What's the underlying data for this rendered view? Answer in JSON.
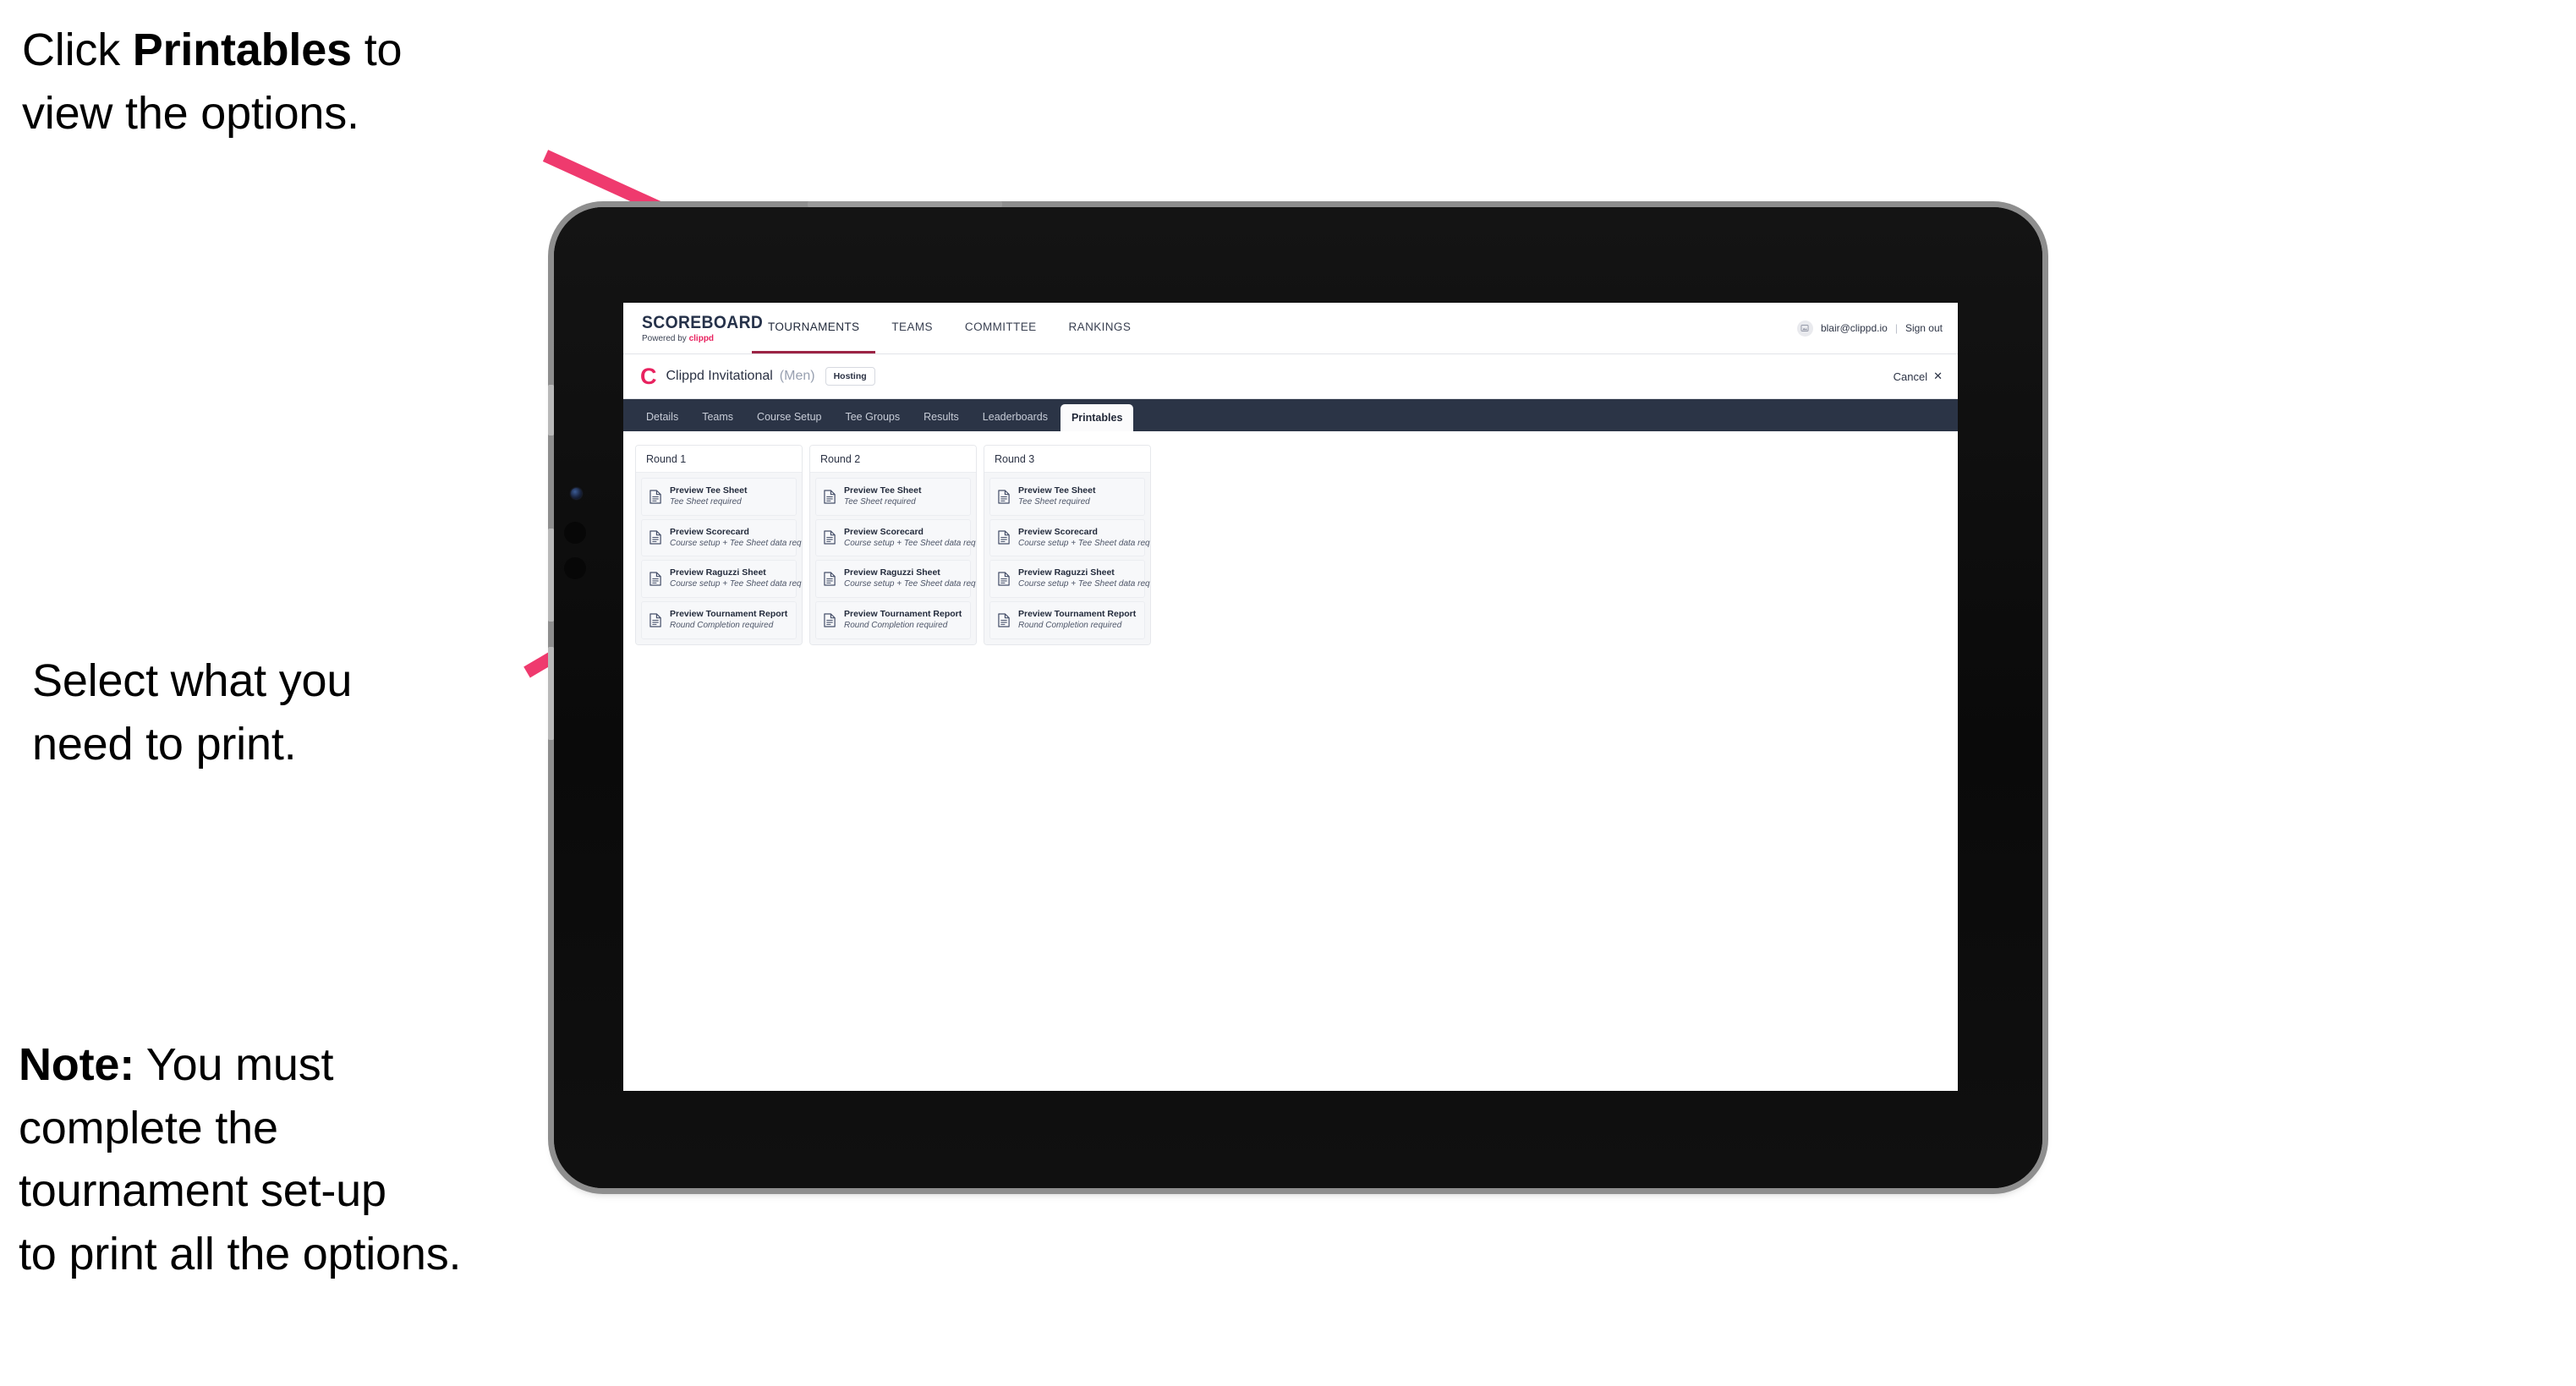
{
  "annotations": {
    "click_printables": "Click Printables to\nview the options.",
    "click_printables_bold": "Printables",
    "click_printables_pre": "Click ",
    "click_printables_post": " to\nview the options.",
    "select_print": "Select what you\n need to print.",
    "note_bold": "Note:",
    "note_rest": " You must\ncomplete the\ntournament set-up\nto print all the options."
  },
  "colors": {
    "accent_pink": "#ef3a6e",
    "brand_pink": "#e8225f",
    "navy": "#2b3446",
    "active_underline": "#9c2345"
  },
  "screen": {
    "appbar": {
      "brand_title": "SCOREBOARD",
      "brand_sub_prefix": "Powered by ",
      "brand_sub_name": "clippd",
      "nav": [
        {
          "label": "TOURNAMENTS",
          "active": true
        },
        {
          "label": "TEAMS",
          "active": false
        },
        {
          "label": "COMMITTEE",
          "active": false
        },
        {
          "label": "RANKINGS",
          "active": false
        }
      ],
      "user_email": "blair@clippd.io",
      "divider": "|",
      "sign_out": "Sign out",
      "avatar_glyph": "▣"
    },
    "tournament_bar": {
      "logo_letter": "C",
      "name": "Clippd Invitational",
      "gender": "(Men)",
      "badge": "Hosting",
      "cancel_label": "Cancel",
      "cancel_glyph": "✕"
    },
    "subnav": [
      {
        "label": "Details",
        "active": false
      },
      {
        "label": "Teams",
        "active": false
      },
      {
        "label": "Course Setup",
        "active": false
      },
      {
        "label": "Tee Groups",
        "active": false
      },
      {
        "label": "Results",
        "active": false
      },
      {
        "label": "Leaderboards",
        "active": false
      },
      {
        "label": "Printables",
        "active": true
      }
    ],
    "rounds": [
      {
        "title": "Round 1",
        "items": [
          {
            "title": "Preview Tee Sheet",
            "sub": "Tee Sheet required"
          },
          {
            "title": "Preview Scorecard",
            "sub": "Course setup + Tee Sheet data required"
          },
          {
            "title": "Preview Raguzzi Sheet",
            "sub": "Course setup + Tee Sheet data required"
          },
          {
            "title": "Preview Tournament Report",
            "sub": "Round Completion required"
          }
        ]
      },
      {
        "title": "Round 2",
        "items": [
          {
            "title": "Preview Tee Sheet",
            "sub": "Tee Sheet required"
          },
          {
            "title": "Preview Scorecard",
            "sub": "Course setup + Tee Sheet data required"
          },
          {
            "title": "Preview Raguzzi Sheet",
            "sub": "Course setup + Tee Sheet data required"
          },
          {
            "title": "Preview Tournament Report",
            "sub": "Round Completion required"
          }
        ]
      },
      {
        "title": "Round 3",
        "items": [
          {
            "title": "Preview Tee Sheet",
            "sub": "Tee Sheet required"
          },
          {
            "title": "Preview Scorecard",
            "sub": "Course setup + Tee Sheet data required"
          },
          {
            "title": "Preview Raguzzi Sheet",
            "sub": "Course setup + Tee Sheet data required"
          },
          {
            "title": "Preview Tournament Report",
            "sub": "Round Completion required"
          }
        ]
      }
    ]
  }
}
